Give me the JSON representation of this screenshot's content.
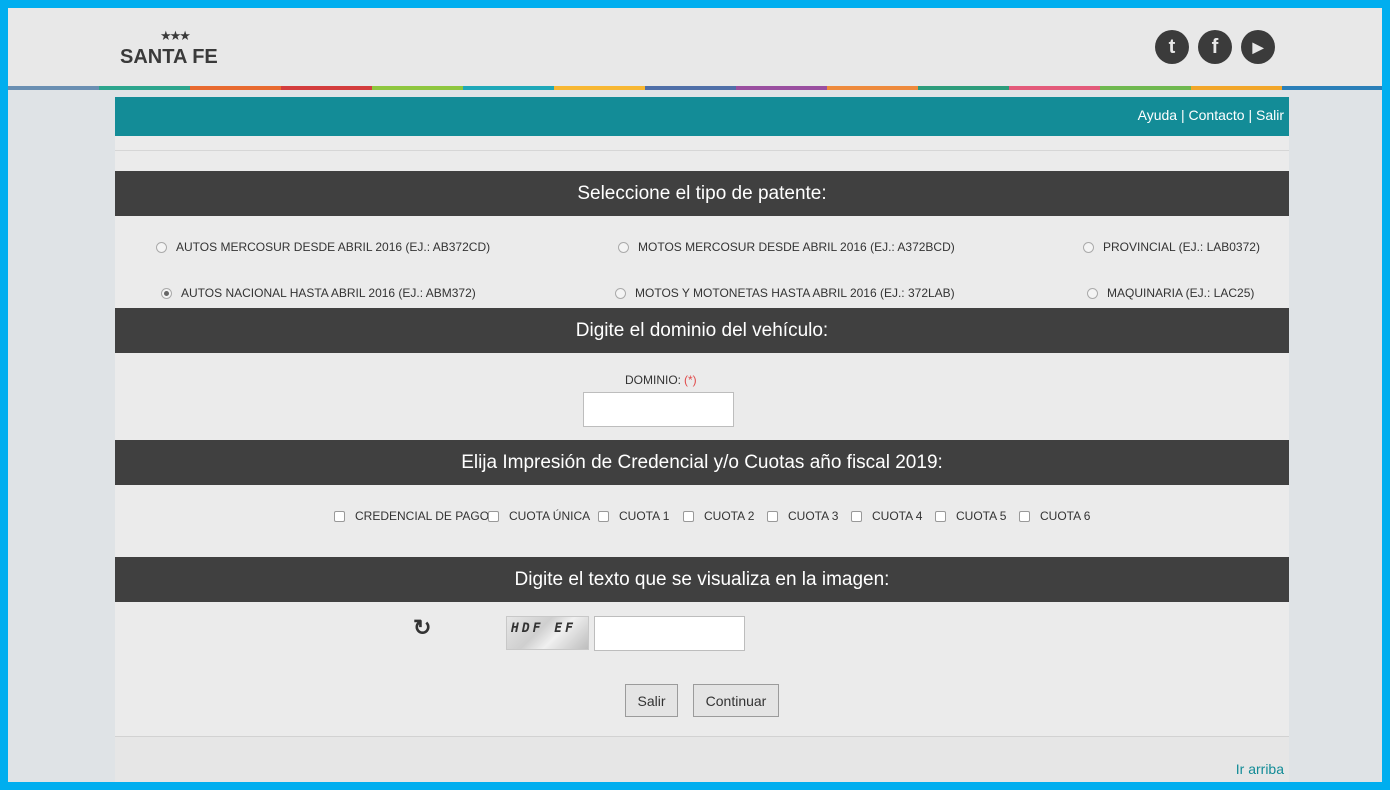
{
  "header": {
    "logo_text": "SANTA FE",
    "social": [
      {
        "name": "twitter-icon",
        "glyph": "t"
      },
      {
        "name": "facebook-icon",
        "glyph": "f"
      },
      {
        "name": "youtube-icon",
        "glyph": "▶"
      }
    ],
    "stripe_colors": [
      "#6a8fb2",
      "#2ca58d",
      "#e86a2f",
      "#d33d3d",
      "#8ec63f",
      "#1fa8b8",
      "#f7b733",
      "#4f6fa8",
      "#9a4fa0",
      "#ee8a3c",
      "#2d9c7b",
      "#e35a7a",
      "#6fb84f",
      "#f2a629",
      "#2b7fb8"
    ]
  },
  "topnav": {
    "links": [
      "Ayuda",
      "Contacto",
      "Salir"
    ],
    "separator": " | "
  },
  "sections": {
    "patente_title": "Seleccione el tipo de patente:",
    "dominio_title": "Digite el dominio del vehículo:",
    "cuotas_title": "Elija Impresión de Credencial y/o Cuotas año fiscal 2019:",
    "captcha_title": "Digite el texto que se visualiza en la imagen:"
  },
  "patente_options": [
    {
      "label": "AUTOS MERCOSUR DESDE ABRIL 2016 (EJ.: AB372CD)",
      "checked": false
    },
    {
      "label": "MOTOS MERCOSUR DESDE ABRIL 2016 (EJ.: A372BCD)",
      "checked": false
    },
    {
      "label": "PROVINCIAL (EJ.: LAB0372)",
      "checked": false
    },
    {
      "label": "AUTOS NACIONAL HASTA ABRIL 2016 (EJ.: ABM372)",
      "checked": true
    },
    {
      "label": "MOTOS Y MOTONETAS HASTA ABRIL 2016 (EJ.: 372LAB)",
      "checked": false
    },
    {
      "label": "MAQUINARIA (EJ.: LAC25)",
      "checked": false
    }
  ],
  "dominio": {
    "label": "DOMINIO:",
    "required_mark": "(*)",
    "value": ""
  },
  "cuotas": [
    "CREDENCIAL DE PAGO",
    "CUOTA ÚNICA",
    "CUOTA 1",
    "CUOTA 2",
    "CUOTA 3",
    "CUOTA 4",
    "CUOTA 5",
    "CUOTA 6"
  ],
  "captcha": {
    "refresh_glyph": "↻",
    "image_text": "HDF EF",
    "value": ""
  },
  "buttons": {
    "salir": "Salir",
    "continuar": "Continuar"
  },
  "footer": {
    "ir_arriba": "Ir arriba"
  }
}
